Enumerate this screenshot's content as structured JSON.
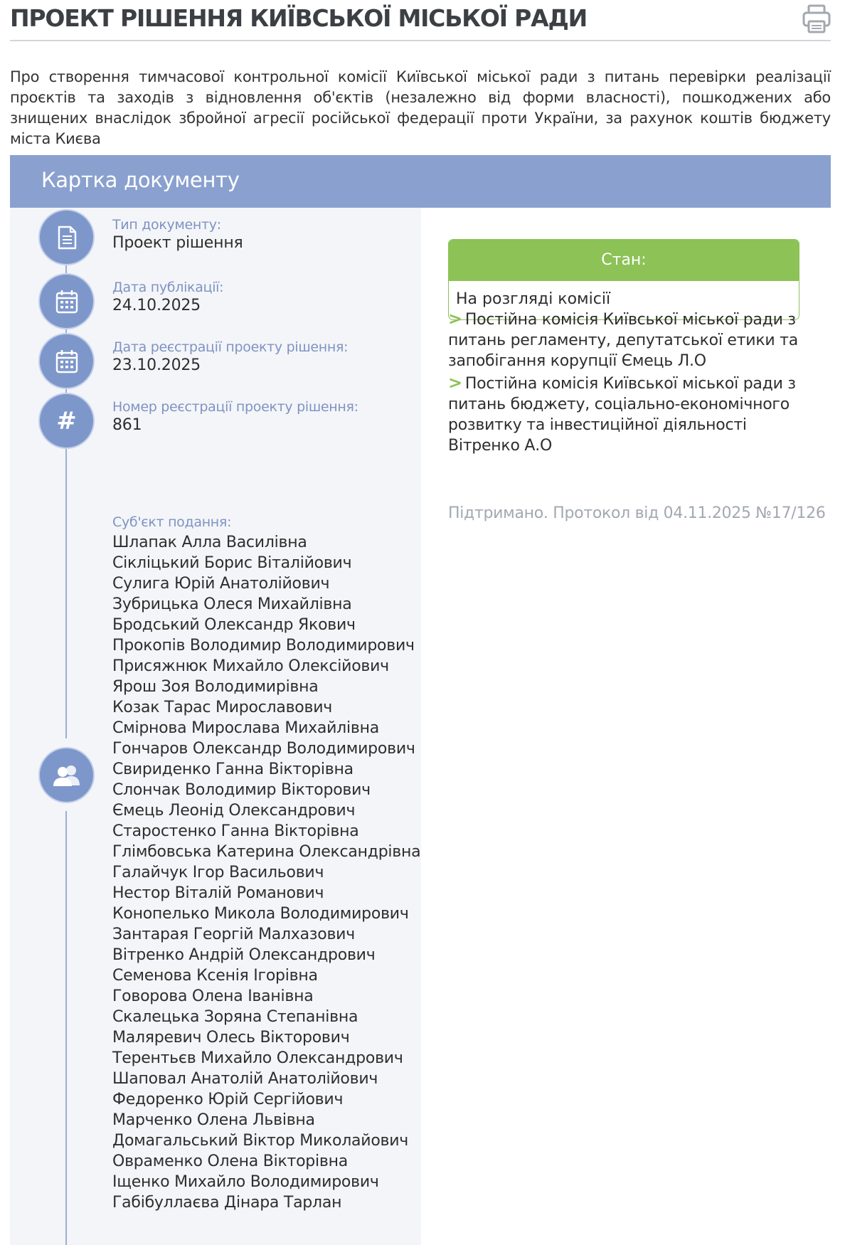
{
  "page": {
    "title": "ПРОЕКТ РІШЕННЯ КИЇВСЬКОЇ МІСЬКОЇ РАДИ",
    "print_icon": "printer-icon",
    "description": "Про створення тимчасової контрольної комісії Київської міської ради з питань перевірки реалізації проєктів та заходів з відновлення об'єктів (незалежно від форми власності), пошкоджених або знищених внаслідок збройної агресії російської федерації проти України, за рахунок коштів бюджету міста Києва"
  },
  "card": {
    "title": "Картка документу",
    "fields": [
      {
        "icon": "document-icon",
        "label": "Тип документу:",
        "value": "Проект рішення"
      },
      {
        "icon": "calendar-icon",
        "label": "Дата публікації:",
        "value": "24.10.2025"
      },
      {
        "icon": "calendar-icon",
        "label": "Дата реєстрації проекту рішення:",
        "value": "23.10.2025"
      },
      {
        "icon": "hash-icon",
        "label": "Номер реєстрації проекту рішення:",
        "value": "861"
      }
    ],
    "submitters_icon": "users-icon",
    "submitters_label": "Суб'єкт подання:",
    "submitters": [
      "Шлапак Алла Василівна",
      "Сікліцький Борис Віталійович",
      "Сулига Юрій Анатолійович",
      "Зубрицька Олеся Михайлівна",
      "Бродський Олександр Якович",
      "Прокопів Володимир Володимирович",
      "Присяжнюк Михайло Олексійович",
      "Ярош Зоя Володимирівна",
      "Козак Тарас Мирославович",
      "Смірнова Мирослава Михайлівна",
      "Гончаров Олександр Володимирович",
      "Свириденко Ганна Вікторівна",
      "Слончак Володимир Вікторович",
      "Ємець Леонід Олександрович",
      "Старостенко Ганна Вікторівна",
      "Глімбовська Катерина Олександрівна",
      "Галайчук Ігор Васильович",
      "Нестор Віталій Романович",
      "Конопелько Микола Володимирович",
      "Зантарая Георгій Малхазович",
      "Вітренко Андрій Олександрович",
      "Семенова Ксенія Ігорівна",
      "Говорова Олена Іванівна",
      "Скалецька Зоряна Степанівна",
      "Маляревич Олесь Вікторович",
      "Терентьєв Михайло Олександрович",
      "Шаповал Анатолій Анатолійович",
      "Федоренко Юрій Сергійович",
      "Марченко Олена Львівна",
      "Домагальський Віктор Миколайович",
      "Овраменко Олена Вікторівна",
      "Іщенко Михайло Володимирович",
      "Габібуллаєва Дінара Тарлан"
    ]
  },
  "status": {
    "label": "Стан:",
    "value": "На розгляді комісії",
    "accent_color": "#8cc256"
  },
  "commissions": [
    {
      "icon": "chevron-right-icon",
      "text": "Постійна комісія Київської міської ради з питань регламенту, депутатської етики та запобігання корупції Ємець Л.О"
    },
    {
      "icon": "chevron-right-icon",
      "text": "Постійна комісія Київської міської ради з питань бюджету, соціально-економічного розвитку та інвестиційної діяльності Вітренко А.О"
    }
  ],
  "protocol_note": "Підтримано. Протокол від 04.11.2025 №17/126",
  "colors": {
    "card_header": "#8aa1cf",
    "icon_circle": "#7e97cb",
    "label_text": "#7e93c4",
    "left_panel": "#f4f5f8",
    "muted_text": "#a3a8b0"
  }
}
